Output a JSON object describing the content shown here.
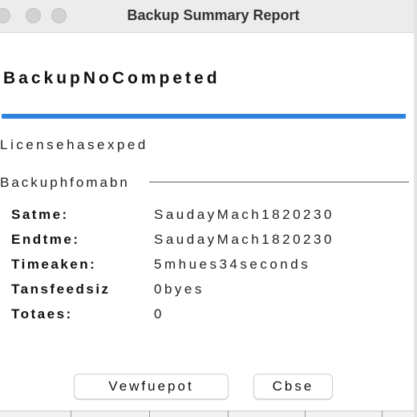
{
  "window": {
    "title": "Backup Summary Report"
  },
  "status": {
    "heading": "BackupNoCompeted",
    "progress_percent": 100,
    "progress_color": "#2f84e0",
    "license_message": "Licensehasexped"
  },
  "info": {
    "section_title": "Backuphfomabn",
    "rows": [
      {
        "label": "Satme:",
        "value": "SaudayMach1820230"
      },
      {
        "label": "Endtme:",
        "value": "SaudayMach1820230"
      },
      {
        "label": "Timeaken:",
        "value": "5mhues34seconds"
      },
      {
        "label": "Tansfeedsiz",
        "value": "0byes"
      },
      {
        "label": "Totaes:",
        "value": "0"
      }
    ]
  },
  "buttons": {
    "view_report": "Vewfuepot",
    "close": "Cbse"
  },
  "icons": {
    "close": "close-icon",
    "minimize": "minimize-icon",
    "maximize": "maximize-icon"
  }
}
